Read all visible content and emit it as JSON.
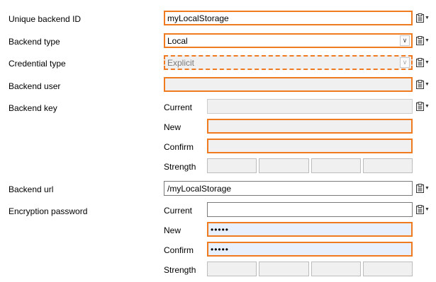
{
  "labels": {
    "backend_id": "Unique backend ID",
    "backend_type": "Backend type",
    "credential_type": "Credential type",
    "backend_user": "Backend user",
    "backend_key": "Backend key",
    "backend_url": "Backend url",
    "encryption_password": "Encryption password"
  },
  "values": {
    "backend_id": "myLocalStorage",
    "backend_type": "Local",
    "credential_type": "Explicit",
    "backend_user": "",
    "backend_url": "/myLocalStorage",
    "enc_new": "•••••",
    "enc_confirm": "•••••"
  },
  "sublabels": {
    "current": "Current",
    "new": "New",
    "confirm": "Confirm",
    "strength": "Strength"
  },
  "colors": {
    "required_border": "#f07a20",
    "disabled_bg": "#f0f0f0",
    "autofill_bg": "#e8f0fe"
  },
  "icons": {
    "field_action": "clipboard-icon",
    "dropdown": "chevron-down-icon"
  }
}
